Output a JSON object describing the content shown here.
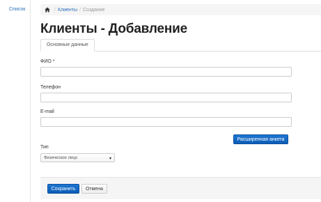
{
  "sidebar": {
    "list_link": "Список"
  },
  "breadcrumb": {
    "clients": "Клиенты",
    "separator": "/",
    "current": "Создание"
  },
  "page": {
    "title": "Клиенты - Добавление"
  },
  "tabs": [
    {
      "label": "Основные данные"
    }
  ],
  "form": {
    "fio": {
      "label": "ФИО *",
      "value": "",
      "placeholder": ""
    },
    "phone": {
      "label": "Телефон",
      "value": "",
      "placeholder": ""
    },
    "email": {
      "label": "E-mail",
      "value": "",
      "placeholder": ""
    },
    "extended_button": "Расширенная анкета",
    "type": {
      "label": "Тип",
      "selected": "Физическое лицо",
      "caret": "▾"
    }
  },
  "actions": {
    "save": "Сохранить",
    "cancel": "Отмена"
  },
  "colors": {
    "link": "#2a6ebb",
    "primary": "#0e5cb5"
  },
  "icons": {
    "home": "home-icon"
  }
}
